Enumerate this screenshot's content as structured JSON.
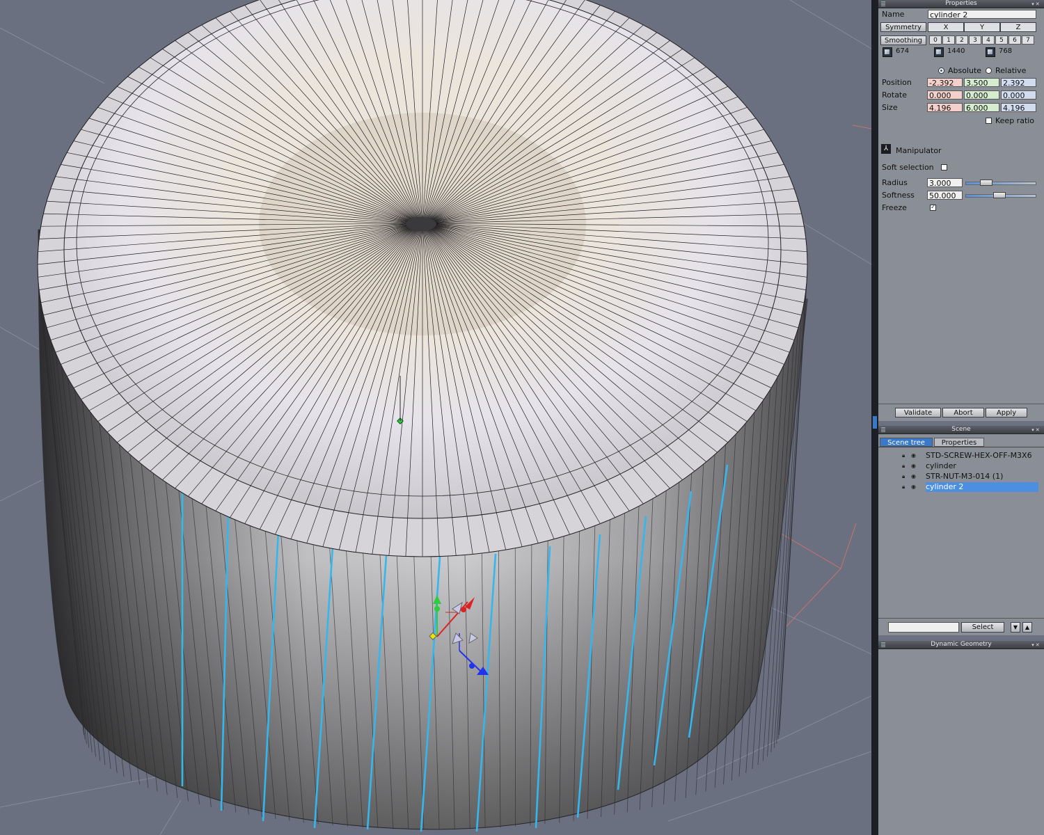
{
  "properties_panel": {
    "title": "Properties",
    "name_label": "Name",
    "name_value": "cylinder 2",
    "symmetry_button": "Symmetry",
    "symmetry_axes": [
      "X",
      "Y",
      "Z"
    ],
    "smoothing_button": "Smoothing",
    "smoothing_levels": [
      "0",
      "1",
      "2",
      "3",
      "4",
      "5",
      "6",
      "7"
    ],
    "stats": [
      "674",
      "1440",
      "768"
    ],
    "absolute_label": "Absolute",
    "relative_label": "Relative",
    "mode": "Absolute",
    "position_label": "Position",
    "position": [
      "-2.392",
      "3.500",
      "2.392"
    ],
    "rotate_label": "Rotate",
    "rotate": [
      "0.000",
      "0.000",
      "0.000"
    ],
    "size_label": "Size",
    "size": [
      "4.196",
      "6.000",
      "4.196"
    ],
    "keep_ratio_label": "Keep ratio",
    "keep_ratio": false,
    "manipulator_label": "Manipulator",
    "soft_selection_label": "Soft selection",
    "soft_selection": false,
    "radius_label": "Radius",
    "radius_value": "3.000",
    "softness_label": "Softness",
    "softness_value": "50.000",
    "freeze_label": "Freeze",
    "freeze": true,
    "validate_button": "Validate",
    "abort_button": "Abort",
    "apply_button": "Apply"
  },
  "scene_panel": {
    "title": "Scene",
    "tabs": [
      "Scene tree",
      "Properties"
    ],
    "active_tab": "Scene tree",
    "items": [
      {
        "label": "STD-SCREW-HEX-OFF-M3X6",
        "selected": false
      },
      {
        "label": "cylinder",
        "selected": false
      },
      {
        "label": "STR-NUT-M3-014 (1)",
        "selected": false
      },
      {
        "label": "cylinder 2",
        "selected": true
      }
    ],
    "search_value": "",
    "select_button": "Select"
  },
  "dynamic_geometry_panel": {
    "title": "Dynamic Geometry"
  },
  "colors": {
    "viewport_bg": "#6a7080",
    "panel_bg": "#8a8e96",
    "selection": "#4c8fe0",
    "selected_edges": "#34b6ee"
  }
}
